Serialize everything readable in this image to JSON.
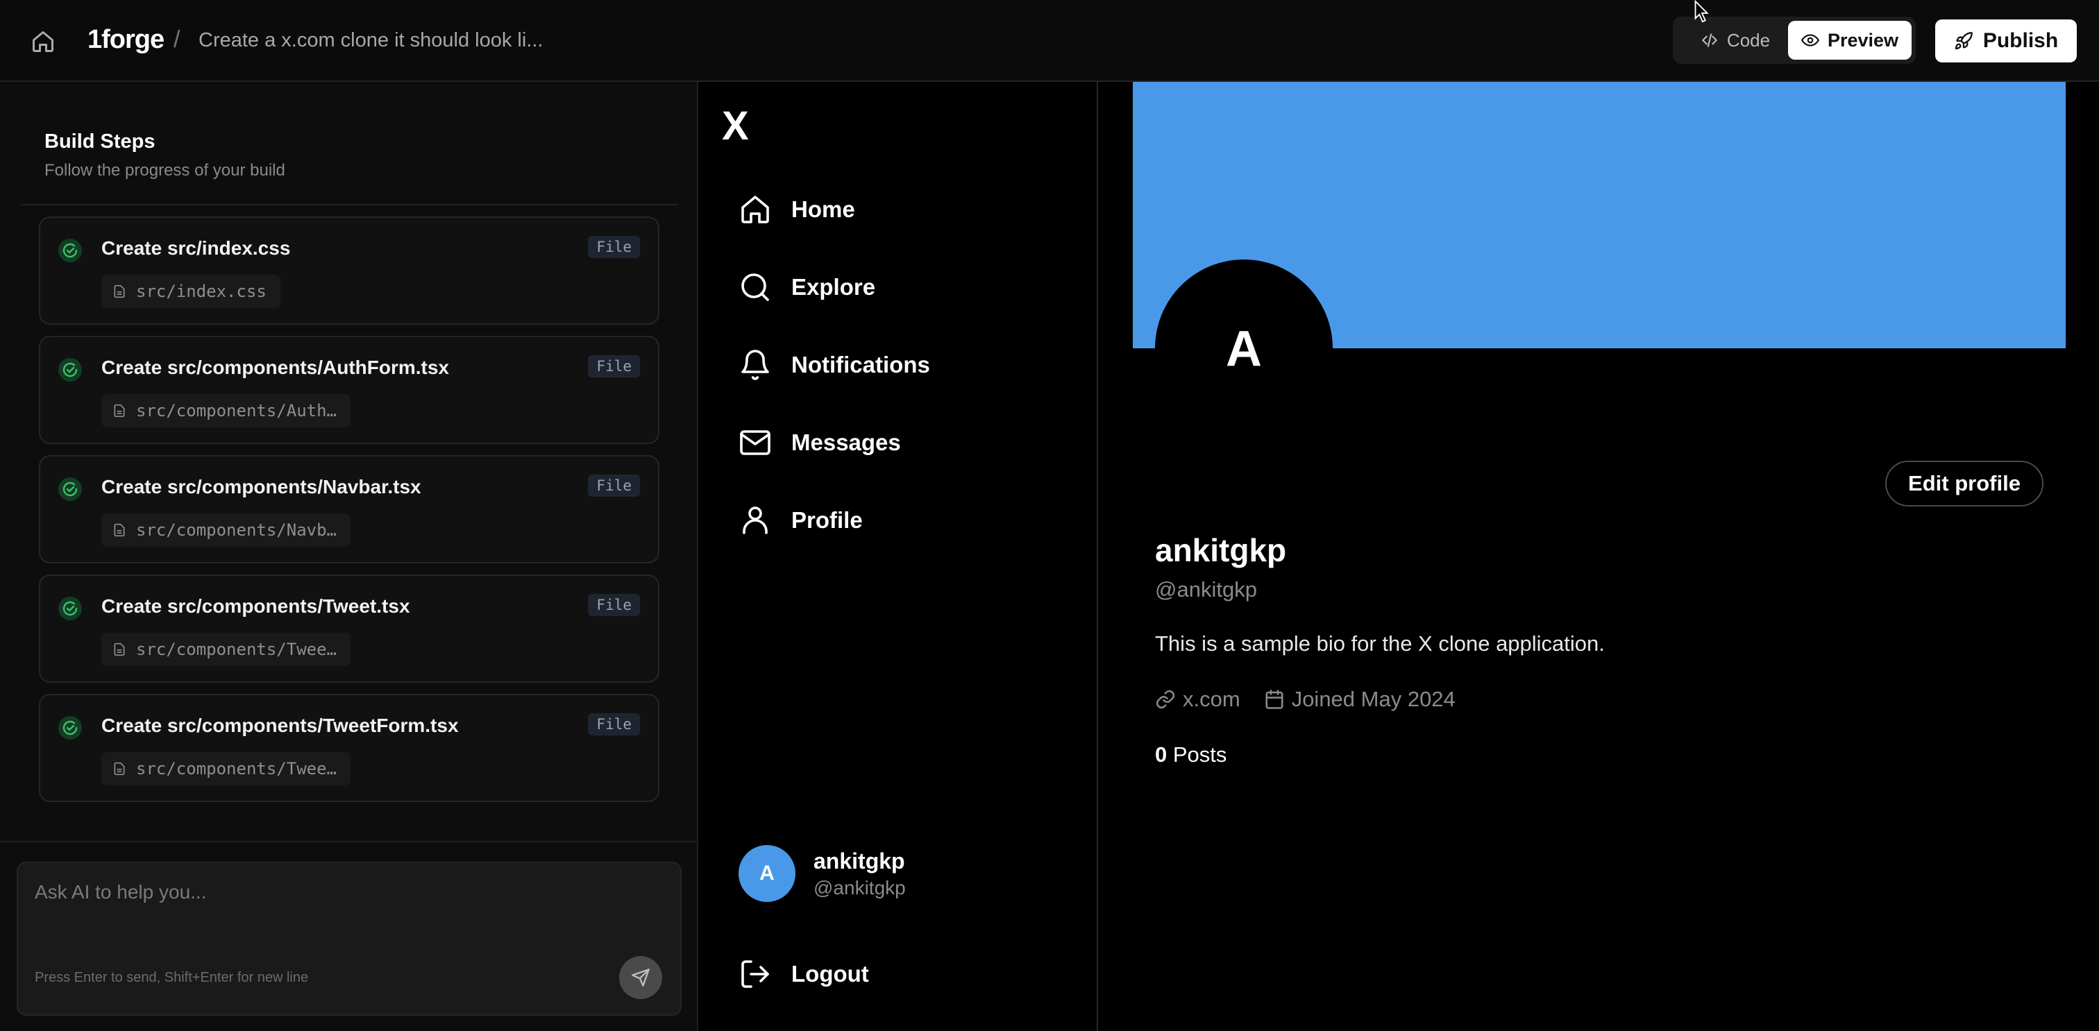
{
  "topbar": {
    "brand": "1forge",
    "separator": "/",
    "breadcrumb": "Create a x.com clone it should look li...",
    "code_label": "Code",
    "preview_label": "Preview",
    "publish_label": "Publish"
  },
  "build": {
    "title": "Build Steps",
    "subtitle": "Follow the progress of your build",
    "steps": [
      {
        "title": "Create src/index.css",
        "badge": "File",
        "file": "src/index.css"
      },
      {
        "title": "Create src/components/AuthForm.tsx",
        "badge": "File",
        "file": "src/components/Auth…"
      },
      {
        "title": "Create src/components/Navbar.tsx",
        "badge": "File",
        "file": "src/components/Navb…"
      },
      {
        "title": "Create src/components/Tweet.tsx",
        "badge": "File",
        "file": "src/components/Twee…"
      },
      {
        "title": "Create src/components/TweetForm.tsx",
        "badge": "File",
        "file": "src/components/Twee…"
      }
    ]
  },
  "chat": {
    "placeholder": "Ask AI to help you...",
    "hint": "Press Enter to send, Shift+Enter for new line"
  },
  "xapp": {
    "logo": "X",
    "nav": [
      {
        "label": "Home",
        "icon": "home-icon"
      },
      {
        "label": "Explore",
        "icon": "search-icon"
      },
      {
        "label": "Notifications",
        "icon": "bell-icon"
      },
      {
        "label": "Messages",
        "icon": "mail-icon"
      },
      {
        "label": "Profile",
        "icon": "user-icon"
      }
    ],
    "account": {
      "initial": "A",
      "name": "ankitgkp",
      "handle": "@ankitgkp"
    },
    "logout_label": "Logout"
  },
  "profile": {
    "initial": "A",
    "edit_label": "Edit profile",
    "name": "ankitgkp",
    "handle": "@ankitgkp",
    "bio": "This is a sample bio for the X clone application.",
    "website": "x.com",
    "joined": "Joined May 2024",
    "posts_count": "0",
    "posts_label": "Posts",
    "banner_color": "#4a99e9"
  }
}
